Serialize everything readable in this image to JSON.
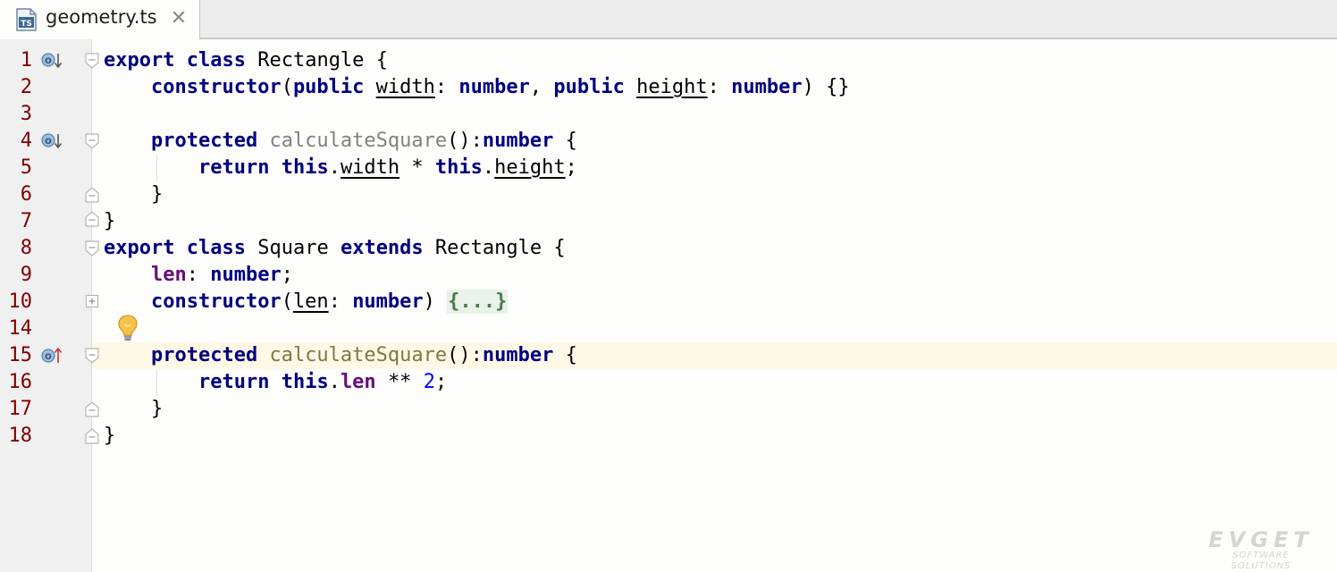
{
  "tab": {
    "icon_text": "TS",
    "icon": "typescript-file-icon",
    "filename": "geometry.ts",
    "close_glyph": "✕"
  },
  "gutter": {
    "line_numbers": [
      "1",
      "2",
      "3",
      "4",
      "5",
      "6",
      "7",
      "8",
      "9",
      "10",
      "14",
      "15",
      "16",
      "17",
      "18"
    ],
    "markers": {
      "implemented": "implemented-method-icon",
      "overrides": "overrides-method-icon",
      "intention": "lightbulb-icon"
    }
  },
  "code": {
    "caret_line": "15",
    "line1": {
      "kw1": "export",
      "kw2": "class",
      "name": "Rectangle",
      "brace": "{"
    },
    "line2": {
      "kw": "constructor",
      "p1": "(",
      "kw_public1": "public",
      "param1": "width",
      "colon1": ":",
      "type1": "number",
      "comma": ",",
      "kw_public2": "public",
      "param2": "height",
      "colon2": ":",
      "type2": "number",
      "end": ") {}"
    },
    "line4": {
      "kw": "protected",
      "method": "calculateSquare",
      "sig": "():",
      "type": "number",
      "brace": "{"
    },
    "line5": {
      "kw": "return",
      "this1": "this",
      "dot1": ".",
      "field1": "width",
      "op": "*",
      "this2": "this",
      "dot2": ".",
      "field2": "height",
      "semi": ";"
    },
    "line6": {
      "text": "}"
    },
    "line7": {
      "text": "}"
    },
    "line8": {
      "kw1": "export",
      "kw2": "class",
      "name": "Square",
      "kw3": "extends",
      "base": "Rectangle",
      "brace": "{"
    },
    "line9": {
      "field": "len",
      "colon": ":",
      "type": "number",
      "semi": ";"
    },
    "line10": {
      "kw": "constructor",
      "p1": "(",
      "param": "len",
      "colon": ":",
      "type": "number",
      "p2": ")",
      "folded": "{...}"
    },
    "line15": {
      "kw": "protected",
      "method": "calculateSquare",
      "sig": "():",
      "type": "number",
      "brace": "{"
    },
    "line16": {
      "kw": "return",
      "this": "this",
      "dot": ".",
      "field": "len",
      "op": "**",
      "num": "2",
      "semi": ";"
    },
    "line17": {
      "text": "}"
    },
    "line18": {
      "text": "}"
    }
  },
  "watermark": {
    "title": "EVGET",
    "subtitle": "SOFTWARE SOLUTIONS"
  },
  "colors": {
    "keyword": "#000080",
    "field": "#660e7a",
    "unused_method": "#808080",
    "method": "#7a7a43",
    "number": "#0000ff",
    "line_number": "#7f0000",
    "caret_row": "#fdf9e6"
  }
}
